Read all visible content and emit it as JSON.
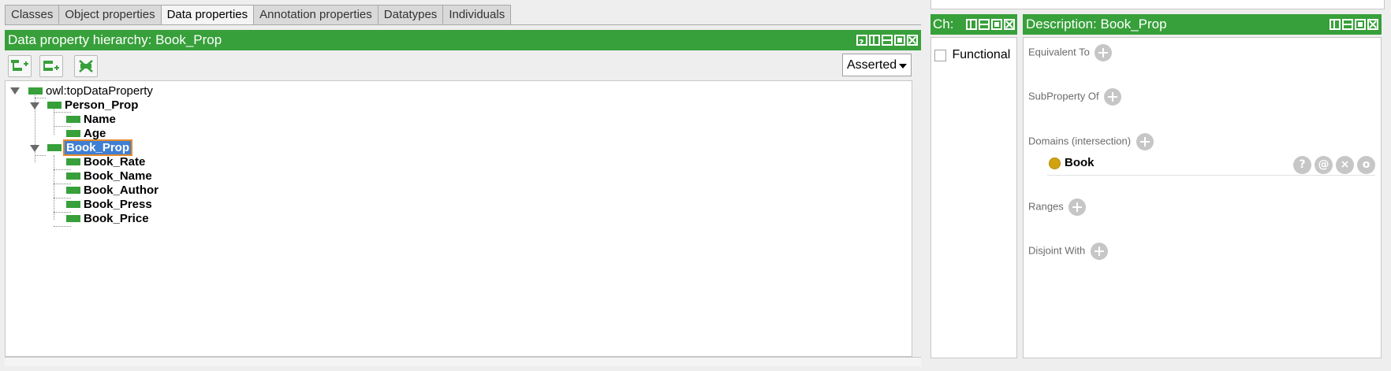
{
  "tabs": [
    {
      "label": "Classes"
    },
    {
      "label": "Object properties"
    },
    {
      "label": "Data properties",
      "active": true
    },
    {
      "label": "Annotation properties"
    },
    {
      "label": "Datatypes"
    },
    {
      "label": "Individuals"
    }
  ],
  "hierarchy": {
    "title": "Data property hierarchy: Book_Prop",
    "mode": "Asserted",
    "tree": {
      "root": "owl:topDataProperty",
      "person": "Person_Prop",
      "person_children": [
        "Name",
        "Age"
      ],
      "book": "Book_Prop",
      "book_children": [
        "Book_Rate",
        "Book_Name",
        "Book_Author",
        "Book_Press",
        "Book_Price"
      ]
    }
  },
  "characteristics": {
    "title": "Ch:",
    "functional": "Functional"
  },
  "description": {
    "title": "Description: Book_Prop",
    "equivalent_to": "Equivalent To",
    "subproperty_of": "SubProperty Of",
    "domains": "Domains (intersection)",
    "domain_item": "Book",
    "ranges": "Ranges",
    "disjoint_with": "Disjoint With",
    "row_actions": [
      "?",
      "@",
      "×",
      "o"
    ]
  },
  "colors": {
    "header_green": "#37a03a",
    "selection_blue": "#3f7fd4",
    "class_gold": "#d1a30f"
  }
}
